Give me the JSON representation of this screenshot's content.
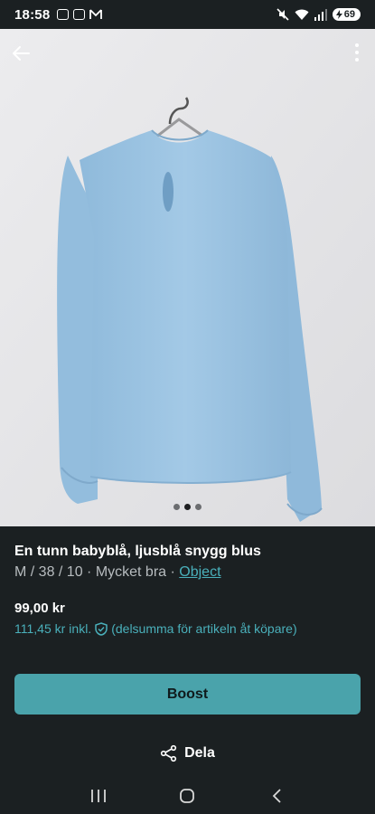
{
  "status_bar": {
    "time": "18:58",
    "battery": "69"
  },
  "listing": {
    "title": "En tunn babyblå, ljusblå snygg blus",
    "meta_prefix": "M / 38 / 10 · Mycket bra · ",
    "brand": "Object",
    "price": "99,00 kr",
    "price_incl": "111,45 kr",
    "incl_label": "inkl.",
    "protection_text": "(delsumma för artikeln åt köpare)"
  },
  "carousel": {
    "total": 3,
    "active_index": 1
  },
  "actions": {
    "boost_label": "Boost",
    "share_label": "Dela"
  },
  "colors": {
    "accent": "#4ab0bb",
    "button": "#4aa3ab",
    "background": "#1b2022",
    "blouse": "#9fc6e4"
  }
}
